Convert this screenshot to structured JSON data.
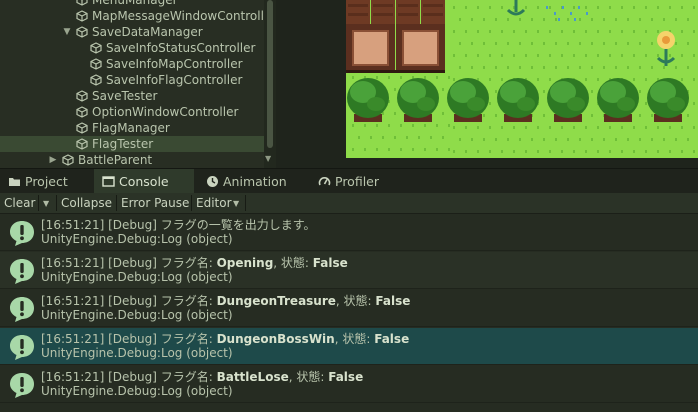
{
  "hierarchy": {
    "items": [
      {
        "label": "MenuManager",
        "indent": 1
      },
      {
        "label": "MapMessageWindowController",
        "indent": 1
      },
      {
        "label": "SaveDataManager",
        "indent": 1,
        "expanded": true
      },
      {
        "label": "SaveInfoStatusController",
        "indent": 2
      },
      {
        "label": "SaveInfoMapController",
        "indent": 2
      },
      {
        "label": "SaveInfoFlagController",
        "indent": 2
      },
      {
        "label": "SaveTester",
        "indent": 1
      },
      {
        "label": "OptionWindowController",
        "indent": 1
      },
      {
        "label": "FlagManager",
        "indent": 1
      },
      {
        "label": "FlagTester",
        "indent": 1,
        "selected": true
      },
      {
        "label": "BattleParent",
        "indent": 0,
        "collapsed": true
      }
    ]
  },
  "tabs": [
    {
      "label": "Project",
      "icon": "folder-icon"
    },
    {
      "label": "Console",
      "icon": "console-icon",
      "active": true
    },
    {
      "label": "Animation",
      "icon": "animation-icon"
    },
    {
      "label": "Profiler",
      "icon": "profiler-icon"
    }
  ],
  "toolbar": {
    "clear": "Clear",
    "collapse": "Collapse",
    "error_pause": "Error Pause",
    "editor": "Editor"
  },
  "log": {
    "entries": [
      {
        "prefix": "[16:51:21] [Debug] フラグの一覧を出力します。",
        "name": "",
        "mid": "",
        "value": "",
        "stack": "UnityEngine.Debug:Log (object)"
      },
      {
        "prefix": "[16:51:21] [Debug] フラグ名: ",
        "name": "Opening",
        "mid": ", 状態: ",
        "value": "False",
        "stack": "UnityEngine.Debug:Log (object)"
      },
      {
        "prefix": "[16:51:21] [Debug] フラグ名: ",
        "name": "DungeonTreasure",
        "mid": ", 状態: ",
        "value": "False",
        "stack": "UnityEngine.Debug:Log (object)"
      },
      {
        "prefix": "[16:51:21] [Debug] フラグ名: ",
        "name": "DungeonBossWin",
        "mid": ", 状態: ",
        "value": "False",
        "stack": "UnityEngine.Debug:Log (object)",
        "selected": true
      },
      {
        "prefix": "[16:51:21] [Debug] フラグ名: ",
        "name": "BattleLose",
        "mid": ", 状態: ",
        "value": "False",
        "stack": "UnityEngine.Debug:Log (object)"
      }
    ]
  },
  "colors": {
    "grass": "#8fdc4a",
    "tree": "#3a8a2a",
    "crate": "#8c4a2e",
    "selection": "#1e4a4a",
    "info_icon": "#a8d8a8"
  }
}
